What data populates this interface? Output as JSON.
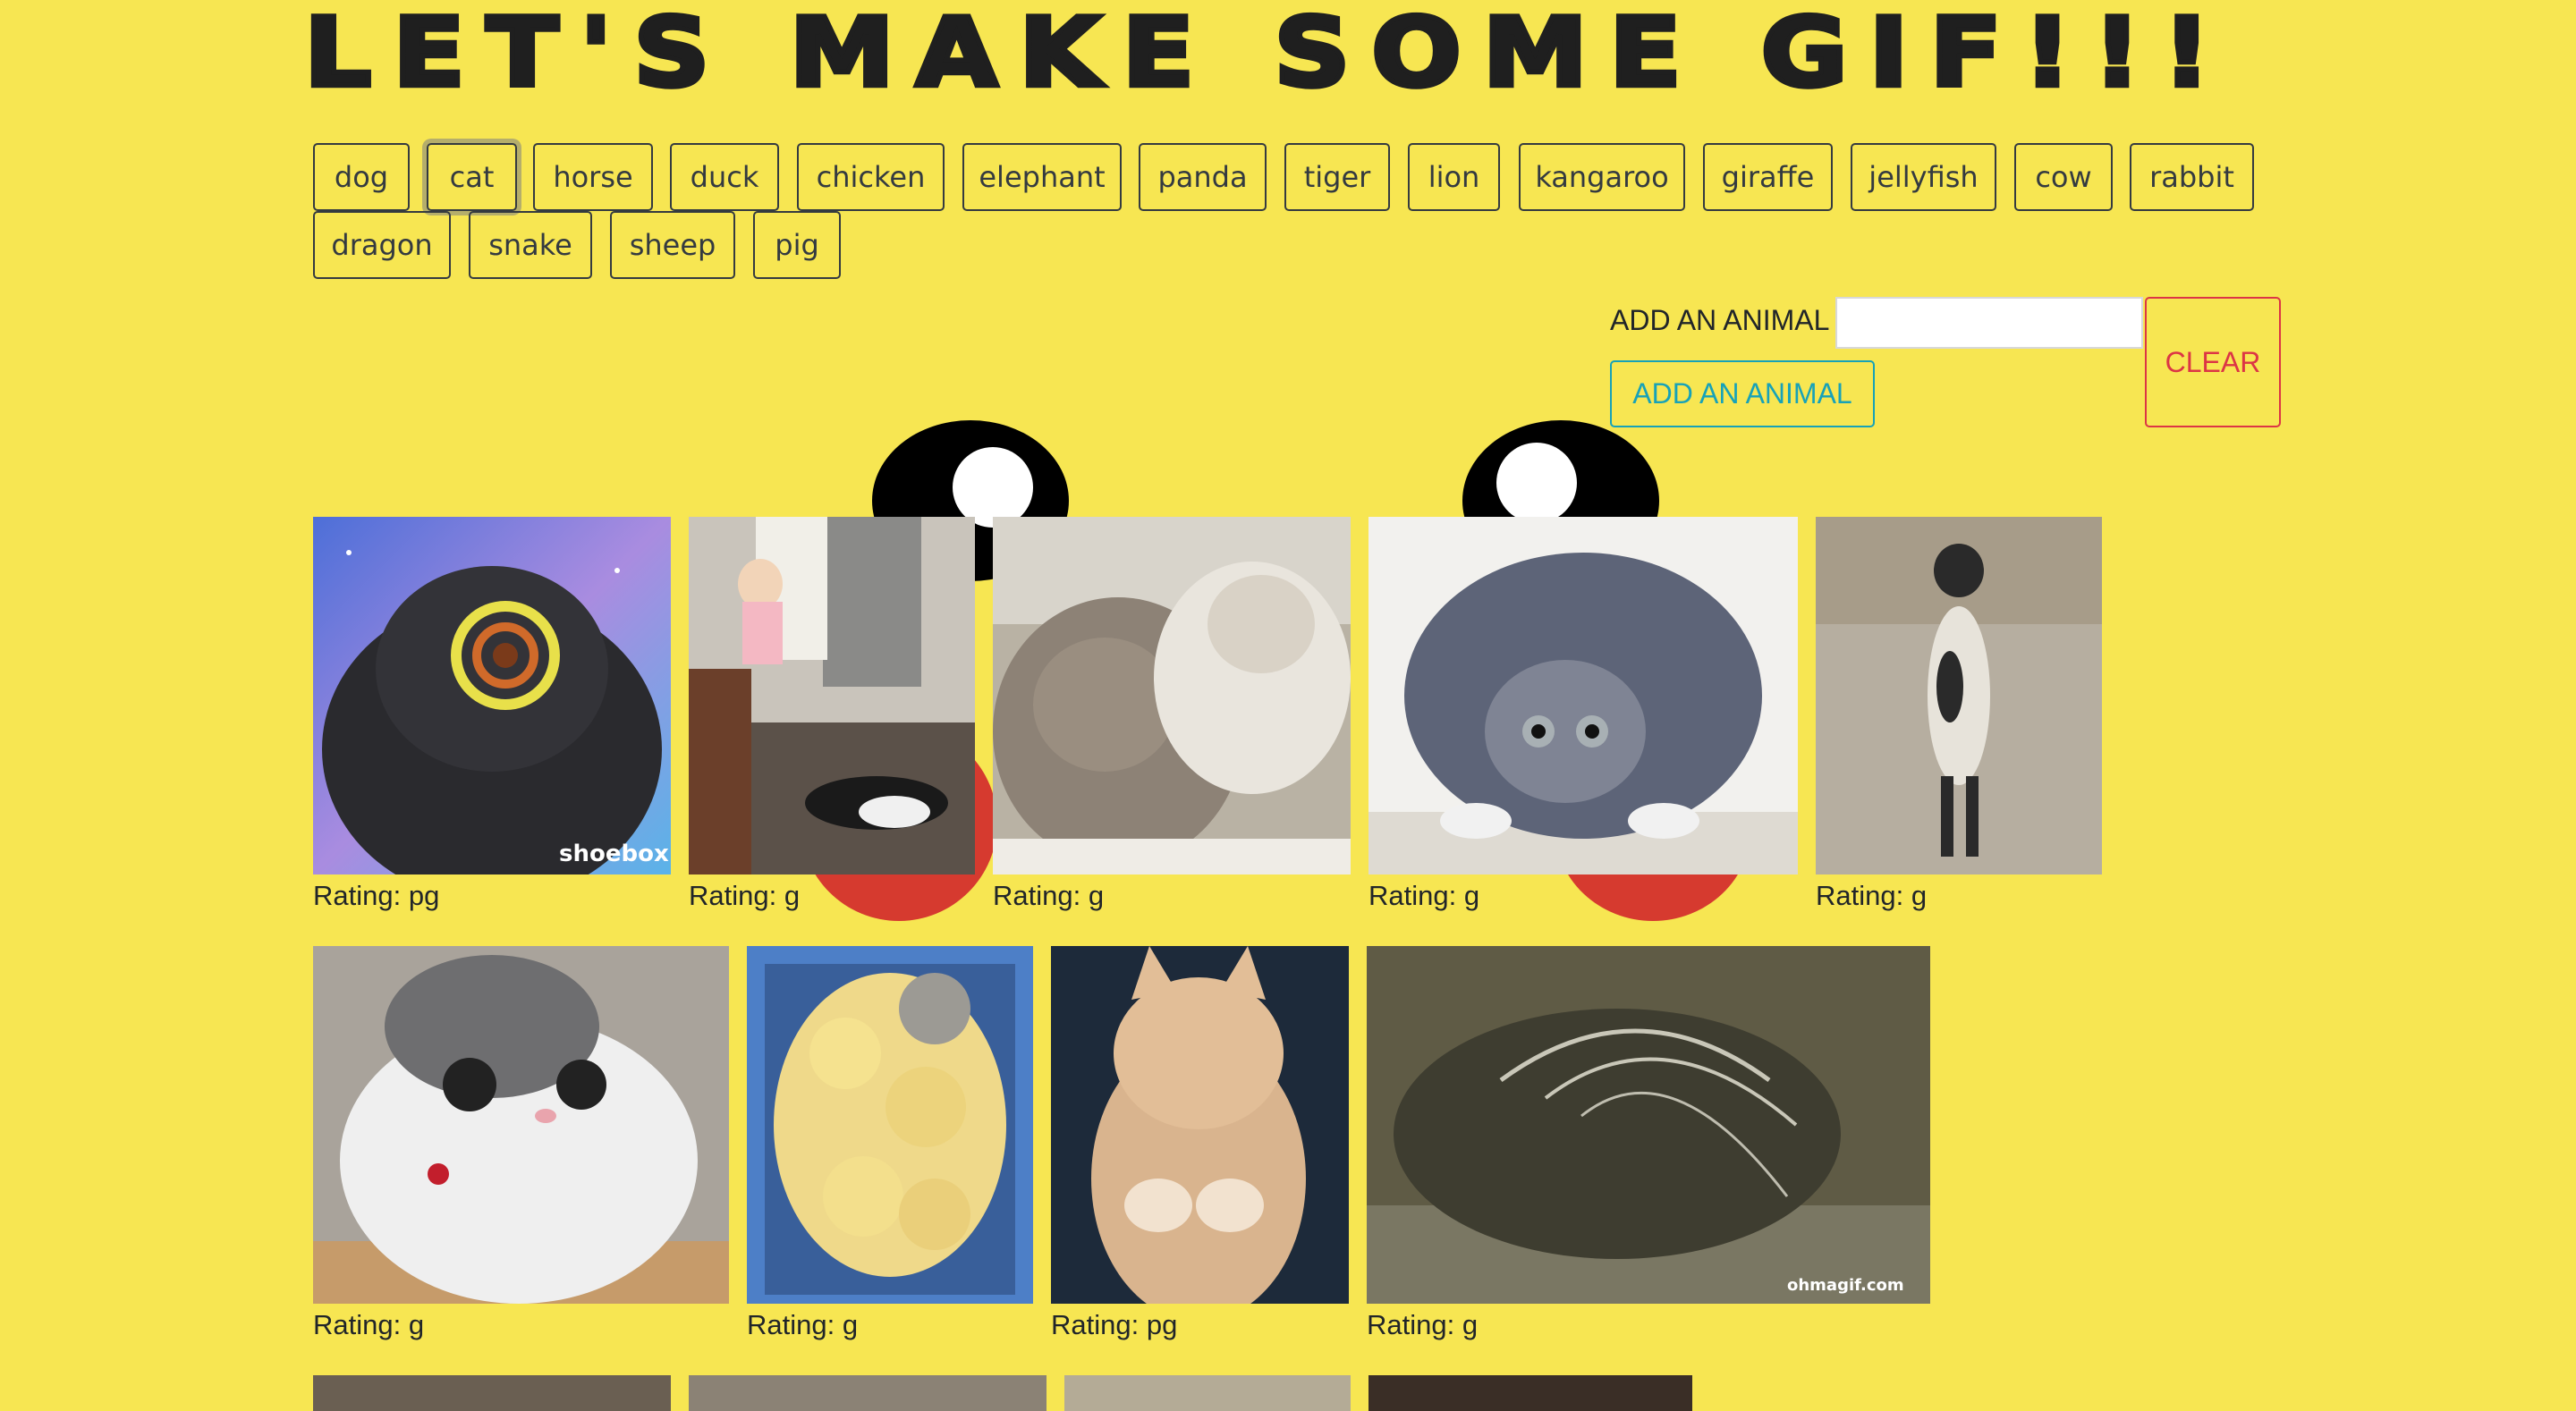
{
  "header": {
    "title": "LET'S MAKE SOME GIF!!!"
  },
  "animals": [
    "dog",
    "cat",
    "horse",
    "duck",
    "chicken",
    "elephant",
    "panda",
    "tiger",
    "lion",
    "kangaroo",
    "giraffe",
    "jellyfish",
    "cow",
    "rabbit",
    "dragon",
    "snake",
    "sheep",
    "pig"
  ],
  "add_form": {
    "label": "ADD AN ANIMAL",
    "input_value": "",
    "input_placeholder": "",
    "submit_label": "ADD AN ANIMAL",
    "clear_label": "CLEAR"
  },
  "gifs": [
    {
      "subject": "fluffy black cat with glowing ring, galaxy background",
      "rating": "Rating: pg",
      "watermark": "shoebox"
    },
    {
      "subject": "toddler and black-white cat in kitchen",
      "rating": "Rating: g"
    },
    {
      "subject": "two cats cuddling",
      "rating": "Rating: g"
    },
    {
      "subject": "tabby cat crouching",
      "rating": "Rating: g"
    },
    {
      "subject": "cat standing on hind legs",
      "rating": "Rating: g"
    },
    {
      "subject": "white-grey cat with red collar",
      "rating": "Rating: g"
    },
    {
      "subject": "kitten among yellow chicks in basket",
      "rating": "Rating: g"
    },
    {
      "subject": "orange kitten stretching",
      "rating": "Rating: pg"
    },
    {
      "subject": "cat with water fountain",
      "rating": "Rating: g",
      "watermark": "ohmagif.com"
    },
    {
      "subject": "cat gif (partially visible)"
    },
    {
      "subject": "cat gif (partially visible)"
    },
    {
      "subject": "cat gif (partially visible)"
    },
    {
      "subject": "cat gif (partially visible)"
    }
  ],
  "colors": {
    "background": "#f7e652",
    "add_button": "#17a2b8",
    "clear_button": "#dc3545",
    "animal_button": "#343a40"
  }
}
